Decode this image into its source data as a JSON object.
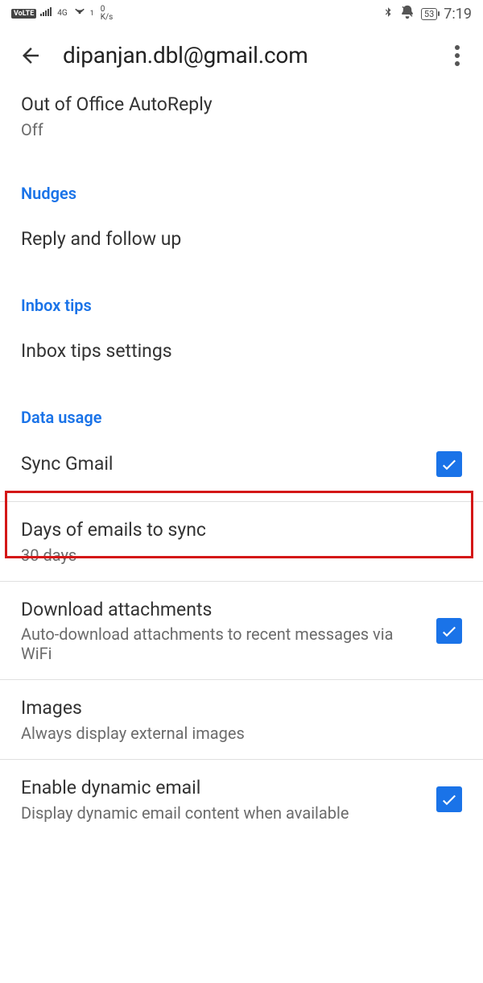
{
  "status": {
    "volte": "VoLTE",
    "net_label": "4G",
    "hotspot_sup": "1",
    "speed_top": "0",
    "speed_unit": "K/s",
    "battery": "53",
    "time": "7:19"
  },
  "appbar": {
    "title": "dipanjan.dbl@gmail.com"
  },
  "items": {
    "ooo_title": "Out of Office AutoReply",
    "ooo_sub": "Off",
    "nudges_header": "Nudges",
    "reply_followup": "Reply and follow up",
    "inbox_tips_header": "Inbox tips",
    "inbox_tips_settings": "Inbox tips settings",
    "data_usage_header": "Data usage",
    "sync_gmail": "Sync Gmail",
    "days_title": "Days of emails to sync",
    "days_sub": "30 days",
    "download_title": "Download attachments",
    "download_sub": "Auto-download attachments to recent messages via WiFi",
    "images_title": "Images",
    "images_sub": "Always display external images",
    "dynamic_title": "Enable dynamic email",
    "dynamic_sub": "Display dynamic email content when available"
  },
  "checks": {
    "sync_gmail": true,
    "download_attachments": true,
    "dynamic_email": true
  }
}
